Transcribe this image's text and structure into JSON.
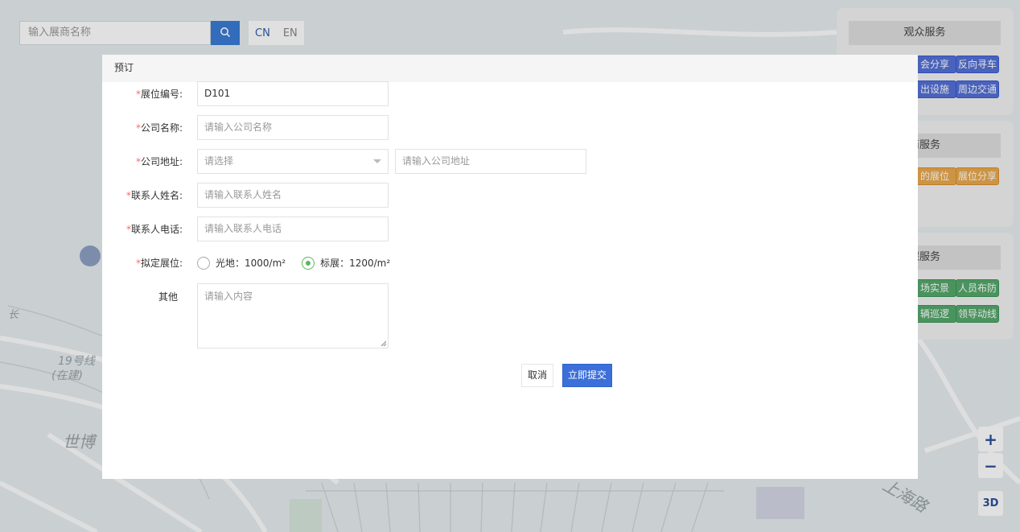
{
  "search": {
    "placeholder": "输入展商名称"
  },
  "lang": {
    "cn": "CN",
    "en": "EN"
  },
  "panels": [
    {
      "title": "观众服务",
      "buttons": [
        "会分享",
        "反向寻车",
        "出设施",
        "周边交通"
      ]
    },
    {
      "title": "商服务",
      "buttons": [
        "的展位",
        "展位分享"
      ]
    },
    {
      "title": "保服务",
      "buttons": [
        "场实景",
        "人员布防",
        "辆巡逻",
        "领导动线"
      ]
    }
  ],
  "map_controls": {
    "zoom_in": "+",
    "zoom_out": "−",
    "three_d": "3D"
  },
  "map_labels": [
    "长",
    "19号线",
    "(在建)",
    "世博",
    "上海路"
  ],
  "modal": {
    "title": "预订",
    "fields": {
      "booth_no": {
        "label": "展位编号:",
        "value": "D101"
      },
      "company_name": {
        "label": "公司名称:",
        "placeholder": "请输入公司名称"
      },
      "company_address": {
        "label": "公司地址:",
        "select_placeholder": "请选择",
        "placeholder": "请输入公司地址"
      },
      "contact_name": {
        "label": "联系人姓名:",
        "placeholder": "请输入联系人姓名"
      },
      "contact_phone": {
        "label": "联系人电话:",
        "placeholder": "请输入联系人电话"
      },
      "booth_type": {
        "label": "拟定展位:",
        "options": [
          "光地：1000/m²",
          "标展：1200/m²"
        ],
        "selected": "标展：1200/m²"
      },
      "other": {
        "label": "其他",
        "placeholder": "请输入内容"
      }
    },
    "required_mark": "*",
    "cancel": "取消",
    "submit": "立即提交"
  },
  "colors": {
    "primary": "#3c6fd8",
    "radio_checked": "#5cb85c",
    "required": "#f56c6c"
  }
}
